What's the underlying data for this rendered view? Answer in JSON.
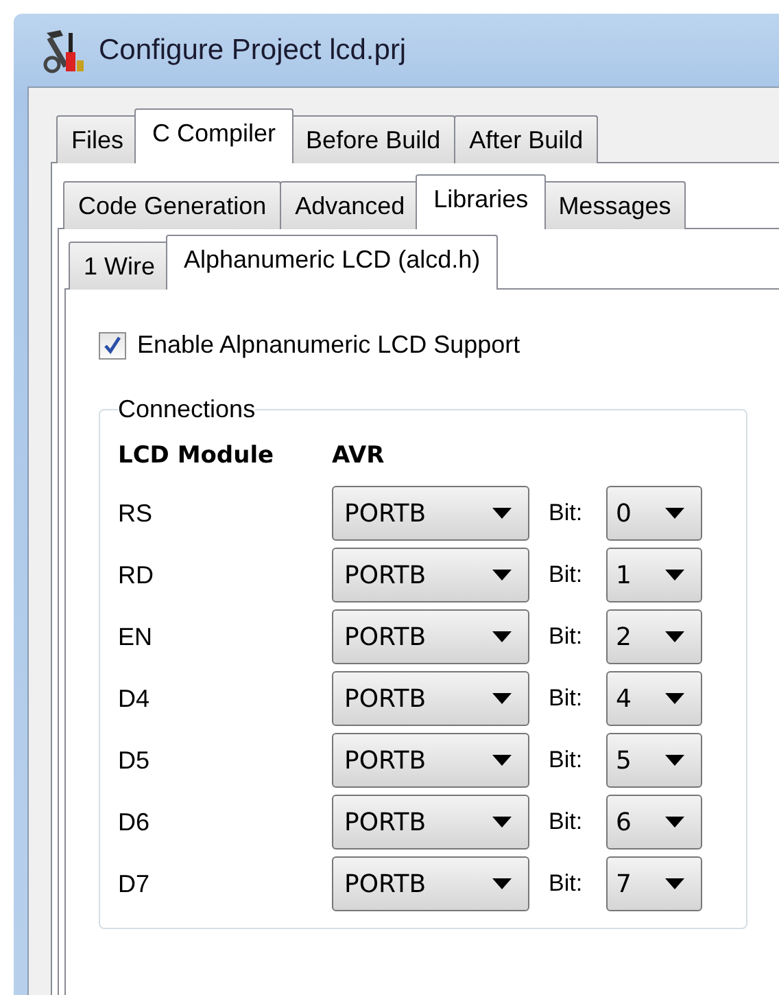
{
  "window": {
    "title": "Configure Project lcd.prj"
  },
  "tabs": [
    {
      "label": "Files",
      "selected": false
    },
    {
      "label": "C Compiler",
      "selected": true
    },
    {
      "label": "Before Build",
      "selected": false
    },
    {
      "label": "After Build",
      "selected": false
    }
  ],
  "compiler_tabs": [
    {
      "label": "Code Generation",
      "selected": false
    },
    {
      "label": "Advanced",
      "selected": false
    },
    {
      "label": "Libraries",
      "selected": true
    },
    {
      "label": "Messages",
      "selected": false
    }
  ],
  "library_tabs": [
    {
      "label": "1 Wire",
      "selected": false
    },
    {
      "label": "Alphanumeric LCD (alcd.h)",
      "selected": true
    }
  ],
  "enable_checkbox": {
    "label": "Enable Alpnanumeric LCD Support",
    "checked": true
  },
  "connections": {
    "title": "Connections",
    "columns": [
      "LCD Module",
      "AVR"
    ],
    "rows": [
      {
        "signal": "RS",
        "port": "PORTB",
        "bit_label": "Bit:",
        "bit": "0"
      },
      {
        "signal": "RD",
        "port": "PORTB",
        "bit_label": "Bit:",
        "bit": "1"
      },
      {
        "signal": "EN",
        "port": "PORTB",
        "bit_label": "Bit:",
        "bit": "2"
      },
      {
        "signal": "D4",
        "port": "PORTB",
        "bit_label": "Bit:",
        "bit": "4"
      },
      {
        "signal": "D5",
        "port": "PORTB",
        "bit_label": "Bit:",
        "bit": "5"
      },
      {
        "signal": "D6",
        "port": "PORTB",
        "bit_label": "Bit:",
        "bit": "6"
      },
      {
        "signal": "D7",
        "port": "PORTB",
        "bit_label": "Bit:",
        "bit": "7"
      }
    ]
  }
}
